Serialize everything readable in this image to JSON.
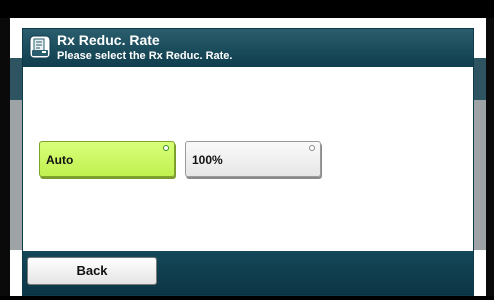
{
  "header": {
    "title": "Rx Reduc. Rate",
    "subtitle": "Please select the Rx Reduc. Rate.",
    "icon": "fax-document-icon"
  },
  "options": [
    {
      "label": "Auto",
      "selected": true
    },
    {
      "label": "100%",
      "selected": false
    }
  ],
  "footer": {
    "back_label": "Back"
  },
  "colors": {
    "header": "#1b4d5d",
    "selected_button": "#ccf765",
    "unselected_button": "#efefef",
    "footer": "#0f3f4f"
  }
}
